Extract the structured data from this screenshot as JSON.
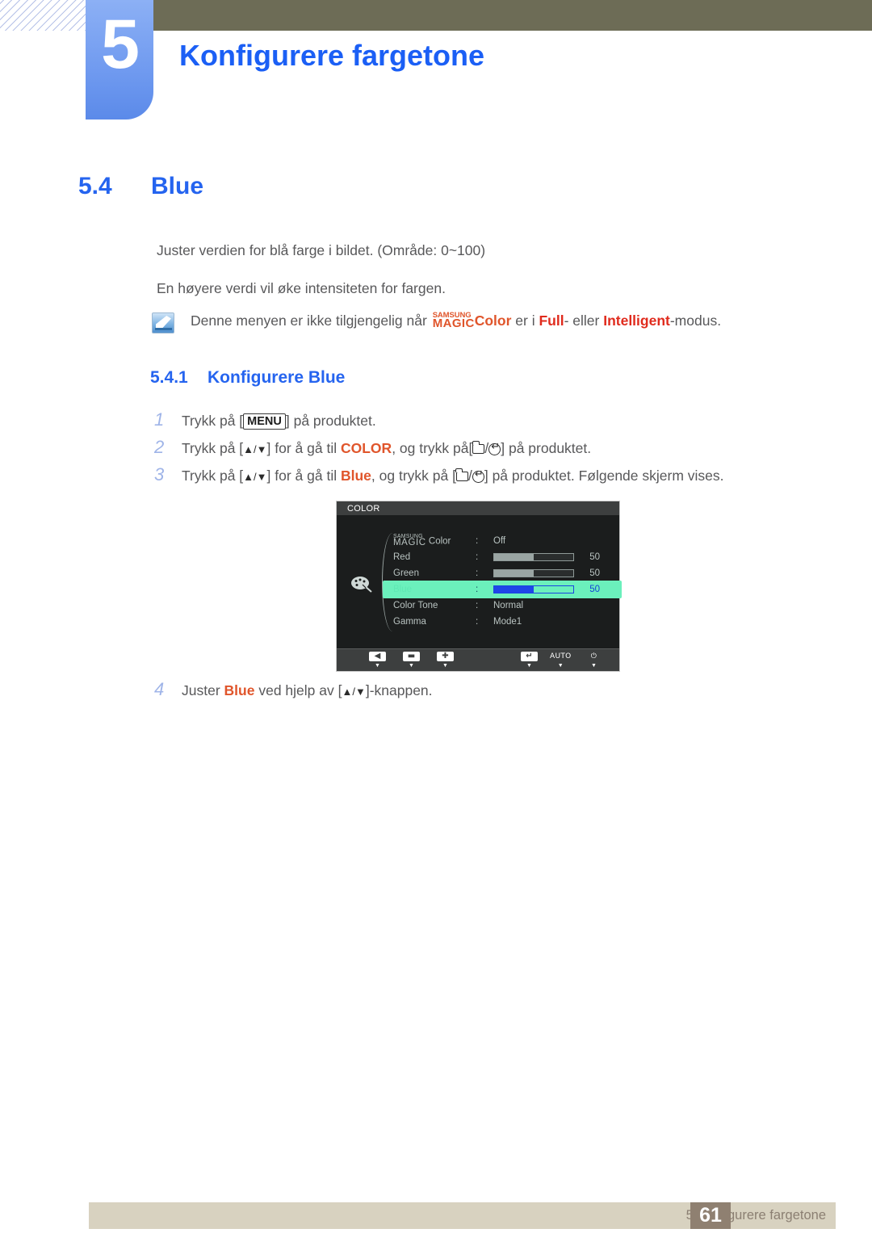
{
  "header": {
    "chapter_number": "5",
    "chapter_title": "Konfigurere fargetone"
  },
  "section": {
    "number": "5.4",
    "title": "Blue"
  },
  "body": {
    "paragraph_1": "Juster verdien for blå farge i bildet. (Område: 0~100)",
    "paragraph_2": "En høyere verdi vil øke intensiteten for fargen."
  },
  "note": {
    "icon": "note-pen-icon",
    "text_before": "Denne menyen er ikke tilgjengelig når",
    "magic_top": "SAMSUNG",
    "magic_bottom": "MAGIC",
    "color_word": "Color",
    "text_mid": "er i",
    "full_word": "Full",
    "text_dash": "- eller",
    "intelligent_word": "Intelligent",
    "text_after": "-modus."
  },
  "subsection": {
    "number": "5.4.1",
    "title": "Konfigurere Blue"
  },
  "steps": [
    {
      "number": "1",
      "prefix": "Trykk på [",
      "key": "MENU",
      "suffix": "] på produktet."
    },
    {
      "number": "2",
      "prefix": "Trykk på [",
      "arrows": "▲/▼",
      "mid": "] for å gå til",
      "target": "COLOR",
      "mid2": ", og trykk på[",
      "suffix": "] på produktet."
    },
    {
      "number": "3",
      "prefix": "Trykk på [",
      "arrows": "▲/▼",
      "mid": "] for å gå til",
      "target": "Blue",
      "mid2": ", og trykk på [",
      "suffix": "] på produktet. Følgende skjerm vises."
    },
    {
      "number": "4",
      "prefix": "Juster",
      "target": "Blue",
      "mid": "ved hjelp av [",
      "arrows": "▲/▼",
      "suffix": "]-knappen."
    }
  ],
  "osd": {
    "title": "COLOR",
    "palette_icon": "palette-icon",
    "rows": [
      {
        "label_top": "SAMSUNG",
        "label_bottom": "MAGIC",
        "label": "Color",
        "separator": ":",
        "value": "Off",
        "type": "text"
      },
      {
        "label": "Red",
        "separator": ":",
        "value": "50",
        "type": "slider",
        "fill_percent": 50,
        "selected": false
      },
      {
        "label": "Green",
        "separator": ":",
        "value": "50",
        "type": "slider",
        "fill_percent": 50,
        "selected": false
      },
      {
        "label": "Blue",
        "separator": ":",
        "value": "50",
        "type": "slider",
        "fill_percent": 50,
        "selected": true
      },
      {
        "label": "Color Tone",
        "separator": ":",
        "value": "Normal",
        "type": "text"
      },
      {
        "label": "Gamma",
        "separator": ":",
        "value": "Mode1",
        "type": "text"
      }
    ],
    "footer_buttons": [
      {
        "icon": "left-arrow-icon",
        "glyph": "◀",
        "label": ""
      },
      {
        "icon": "minus-icon",
        "glyph": "▬",
        "label": ""
      },
      {
        "icon": "plus-icon",
        "glyph": "✚",
        "label": ""
      },
      {
        "icon": "enter-icon",
        "glyph": "↵",
        "label": ""
      },
      {
        "icon": "auto-label",
        "glyph": "AUTO",
        "label": "AUTO"
      },
      {
        "icon": "power-icon",
        "glyph": "⏻",
        "label": ""
      }
    ]
  },
  "footer": {
    "text": "5 Konfigurere fargetone",
    "page_number": "61"
  },
  "colors": {
    "accent_blue": "#2564ef",
    "olive": "#6d6c56",
    "orange": "#e0552b",
    "red": "#e02b1d",
    "footer_bar": "#d8d2c0",
    "page_box": "#8f8071",
    "osd_highlight": "#6bf0bc"
  }
}
